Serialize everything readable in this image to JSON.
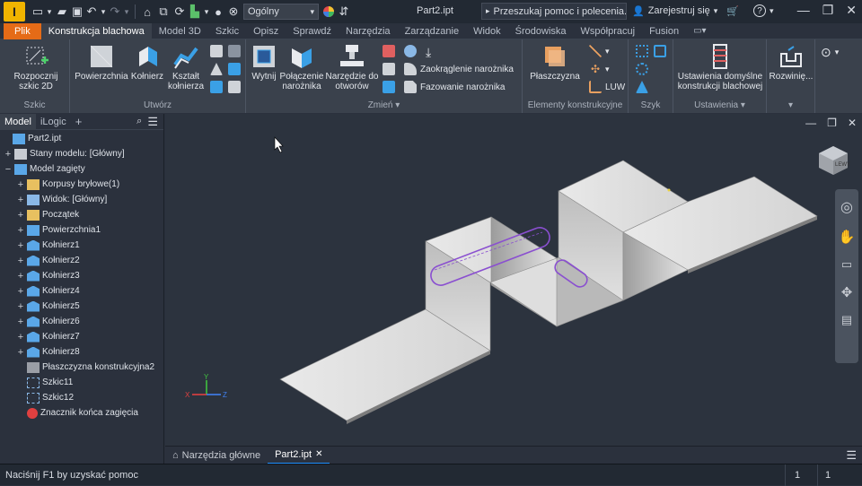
{
  "titlebar": {
    "app_icon": "I",
    "style_value": "Ogólny",
    "document_title": "Part2.ipt",
    "help_search_placeholder": "Przeszukaj pomoc i polecenia...",
    "signin_label": "Zarejestruj się",
    "icons": [
      "new-icon",
      "open-icon",
      "save-icon",
      "undo-icon",
      "redo-icon",
      "home-icon",
      "measure-icon",
      "select-filter-icon",
      "appearance-icon",
      "material-icon",
      "color-wheel-icon",
      "cart-icon",
      "help-icon",
      "minimize-icon",
      "restore-icon",
      "close-icon"
    ]
  },
  "tabs": [
    {
      "label": "Plik"
    },
    {
      "label": "Konstrukcja blachowa"
    },
    {
      "label": "Model 3D"
    },
    {
      "label": "Szkic"
    },
    {
      "label": "Opisz"
    },
    {
      "label": "Sprawdź"
    },
    {
      "label": "Narzędzia"
    },
    {
      "label": "Zarządzanie"
    },
    {
      "label": "Widok"
    },
    {
      "label": "Środowiska"
    },
    {
      "label": "Współpracuj"
    },
    {
      "label": "Fusion"
    }
  ],
  "ribbon": {
    "panels": {
      "szkic": "Szkic",
      "utworz": "Utwórz",
      "zmien": "Zmień",
      "elementy": "Elementy konstrukcyjne",
      "szyk": "Szyk",
      "ustawienia": "Ustawienia"
    },
    "buttons": {
      "start_sketch": "Rozpocznij szkic 2D",
      "face": "Powierzchnia",
      "flange": "Kołnierz",
      "contour_flange": "Kształt kołnierza",
      "cut": "Wytnij",
      "corner_seam": "Połączenie narożnika",
      "punch_tool": "Narzędzie do otworów",
      "corner_round": "Zaokrąglenie narożnika",
      "corner_chamfer": "Fazowanie narożnika",
      "plane": "Płaszczyzna",
      "ucs": "LUW",
      "sheet_metal_defaults": "Ustawienia domyślne konstrukcji blachowej",
      "unfold": "Rozwinię..."
    }
  },
  "browser": {
    "tabs": [
      "Model",
      "iLogic"
    ],
    "add_tab": "+",
    "tree": [
      {
        "label": "Part2.ipt",
        "expander": "",
        "icon": "part-icon",
        "indent": 0
      },
      {
        "label": "Stany modelu: [Główny]",
        "expander": "+",
        "icon": "model-states-icon",
        "indent": 1
      },
      {
        "label": "Model zagięty",
        "expander": "−",
        "icon": "folded-model-icon",
        "indent": 1
      },
      {
        "label": "Korpusy bryłowe(1)",
        "expander": "+",
        "icon": "folder-icon",
        "indent": 2
      },
      {
        "label": "Widok: [Główny]",
        "expander": "+",
        "icon": "view-icon",
        "indent": 2
      },
      {
        "label": "Początek",
        "expander": "+",
        "icon": "folder-icon",
        "indent": 2
      },
      {
        "label": "Powierzchnia1",
        "expander": "+",
        "icon": "face-icon",
        "indent": 2
      },
      {
        "label": "Kołnierz1",
        "expander": "+",
        "icon": "flange-icon",
        "indent": 2
      },
      {
        "label": "Kołnierz2",
        "expander": "+",
        "icon": "flange-icon",
        "indent": 2
      },
      {
        "label": "Kołnierz3",
        "expander": "+",
        "icon": "flange-icon",
        "indent": 2
      },
      {
        "label": "Kołnierz4",
        "expander": "+",
        "icon": "flange-icon",
        "indent": 2
      },
      {
        "label": "Kołnierz5",
        "expander": "+",
        "icon": "flange-icon",
        "indent": 2
      },
      {
        "label": "Kołnierz6",
        "expander": "+",
        "icon": "flange-icon",
        "indent": 2
      },
      {
        "label": "Kołnierz7",
        "expander": "+",
        "icon": "flange-icon",
        "indent": 2
      },
      {
        "label": "Kołnierz8",
        "expander": "+",
        "icon": "flange-icon",
        "indent": 2
      },
      {
        "label": "Płaszczyzna konstrukcyjna2",
        "expander": "",
        "icon": "work-plane-icon",
        "indent": 2
      },
      {
        "label": "Szkic11",
        "expander": "",
        "icon": "sketch-icon",
        "indent": 2
      },
      {
        "label": "Szkic12",
        "expander": "",
        "icon": "sketch-icon",
        "indent": 2
      },
      {
        "label": "Znacznik końca zagięcia",
        "expander": "",
        "icon": "end-of-part-icon",
        "indent": 2
      }
    ]
  },
  "doc_tabs": {
    "home_label": "Narzędzia główne",
    "active_label": "Part2.ipt"
  },
  "status": {
    "help_text": "Naciśnij F1 by uzyskać pomoc",
    "count_1": "1",
    "count_2": "1"
  },
  "viewcube": {
    "label": "LEWY"
  },
  "colors": {
    "accent_file_tab": "#e56b17",
    "app_icon": "#f0b400",
    "selection": "#8a4fd0",
    "model_face": "#c8c8c8"
  }
}
